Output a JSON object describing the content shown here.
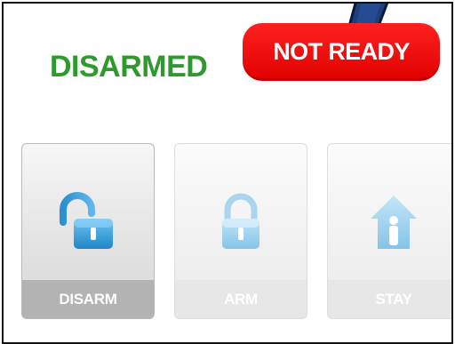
{
  "status": {
    "arm_state": "DISARMED",
    "ready_badge": "NOT READY"
  },
  "mode_buttons": [
    {
      "label": "DISARM",
      "icon": "unlocked-padlock-icon",
      "state": "active"
    },
    {
      "label": "ARM",
      "icon": "locked-padlock-icon",
      "state": "inactive"
    },
    {
      "label": "STAY",
      "icon": "house-person-icon",
      "state": "inactive"
    }
  ],
  "colors": {
    "disarmed_text": "#2e9a2e",
    "not_ready_badge": "#ff1a1a",
    "pointer_arrow": "#1f3f7a"
  }
}
